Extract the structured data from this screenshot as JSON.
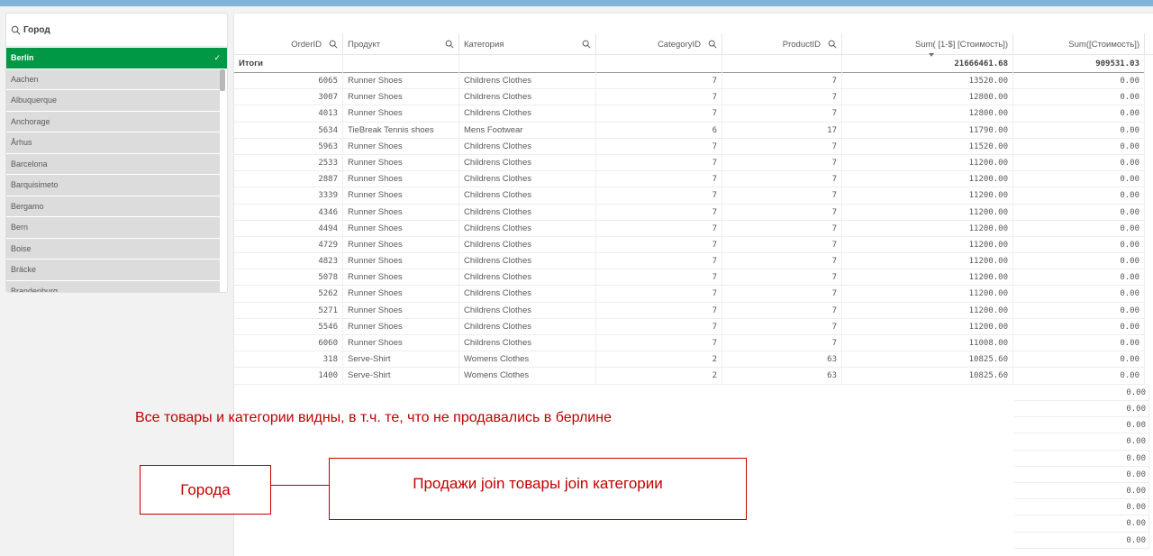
{
  "filter": {
    "title": "Город",
    "items": [
      "Berlin",
      "Aachen",
      "Albuquerque",
      "Anchorage",
      "Århus",
      "Barcelona",
      "Barquisimeto",
      "Bergamo",
      "Bern",
      "Boise",
      "Bräcke",
      "Brandenburg"
    ],
    "selected_check": "✓"
  },
  "table": {
    "columns": [
      "OrderID",
      "Продукт",
      "Категория",
      "CategoryID",
      "ProductID",
      "Sum( [1-$] [Стоимость])",
      "Sum([Стоимость])"
    ],
    "totals": {
      "label": "Итоги",
      "sum1": "21666461.68",
      "sum2": "909531.03"
    },
    "rows": [
      [
        "6065",
        "Runner Shoes",
        "Childrens Clothes",
        "7",
        "7",
        "13520.00",
        "0.00"
      ],
      [
        "3007",
        "Runner Shoes",
        "Childrens Clothes",
        "7",
        "7",
        "12800.00",
        "0.00"
      ],
      [
        "4013",
        "Runner Shoes",
        "Childrens Clothes",
        "7",
        "7",
        "12800.00",
        "0.00"
      ],
      [
        "5634",
        "TieBreak Tennis shoes",
        "Mens Footwear",
        "6",
        "17",
        "11790.00",
        "0.00"
      ],
      [
        "5963",
        "Runner Shoes",
        "Childrens Clothes",
        "7",
        "7",
        "11520.00",
        "0.00"
      ],
      [
        "2533",
        "Runner Shoes",
        "Childrens Clothes",
        "7",
        "7",
        "11200.00",
        "0.00"
      ],
      [
        "2887",
        "Runner Shoes",
        "Childrens Clothes",
        "7",
        "7",
        "11200.00",
        "0.00"
      ],
      [
        "3339",
        "Runner Shoes",
        "Childrens Clothes",
        "7",
        "7",
        "11200.00",
        "0.00"
      ],
      [
        "4346",
        "Runner Shoes",
        "Childrens Clothes",
        "7",
        "7",
        "11200.00",
        "0.00"
      ],
      [
        "4494",
        "Runner Shoes",
        "Childrens Clothes",
        "7",
        "7",
        "11200.00",
        "0.00"
      ],
      [
        "4729",
        "Runner Shoes",
        "Childrens Clothes",
        "7",
        "7",
        "11200.00",
        "0.00"
      ],
      [
        "4823",
        "Runner Shoes",
        "Childrens Clothes",
        "7",
        "7",
        "11200.00",
        "0.00"
      ],
      [
        "5078",
        "Runner Shoes",
        "Childrens Clothes",
        "7",
        "7",
        "11200.00",
        "0.00"
      ],
      [
        "5262",
        "Runner Shoes",
        "Childrens Clothes",
        "7",
        "7",
        "11200.00",
        "0.00"
      ],
      [
        "5271",
        "Runner Shoes",
        "Childrens Clothes",
        "7",
        "7",
        "11200.00",
        "0.00"
      ],
      [
        "5546",
        "Runner Shoes",
        "Childrens Clothes",
        "7",
        "7",
        "11200.00",
        "0.00"
      ],
      [
        "6060",
        "Runner Shoes",
        "Childrens Clothes",
        "7",
        "7",
        "11008.00",
        "0.00"
      ],
      [
        "318",
        "Serve-Shirt",
        "Womens Clothes",
        "2",
        "63",
        "10825.60",
        "0.00"
      ],
      [
        "1400",
        "Serve-Shirt",
        "Womens Clothes",
        "2",
        "63",
        "10825.60",
        "0.00"
      ]
    ],
    "lower_sum2_values": [
      "0.00",
      "0.00",
      "0.00",
      "0.00",
      "0.00",
      "0.00",
      "0.00",
      "0.00",
      "0.00",
      "0.00"
    ]
  },
  "annotations": {
    "note": "Все товары и категории видны, в т.ч. те, что не продавались в берлине",
    "cities_label": "Города",
    "join_label": "Продажи join товары join категории"
  },
  "colors": {
    "selected": "#009845",
    "annotation": "#c00000",
    "topbar": "#7fb3d8"
  }
}
